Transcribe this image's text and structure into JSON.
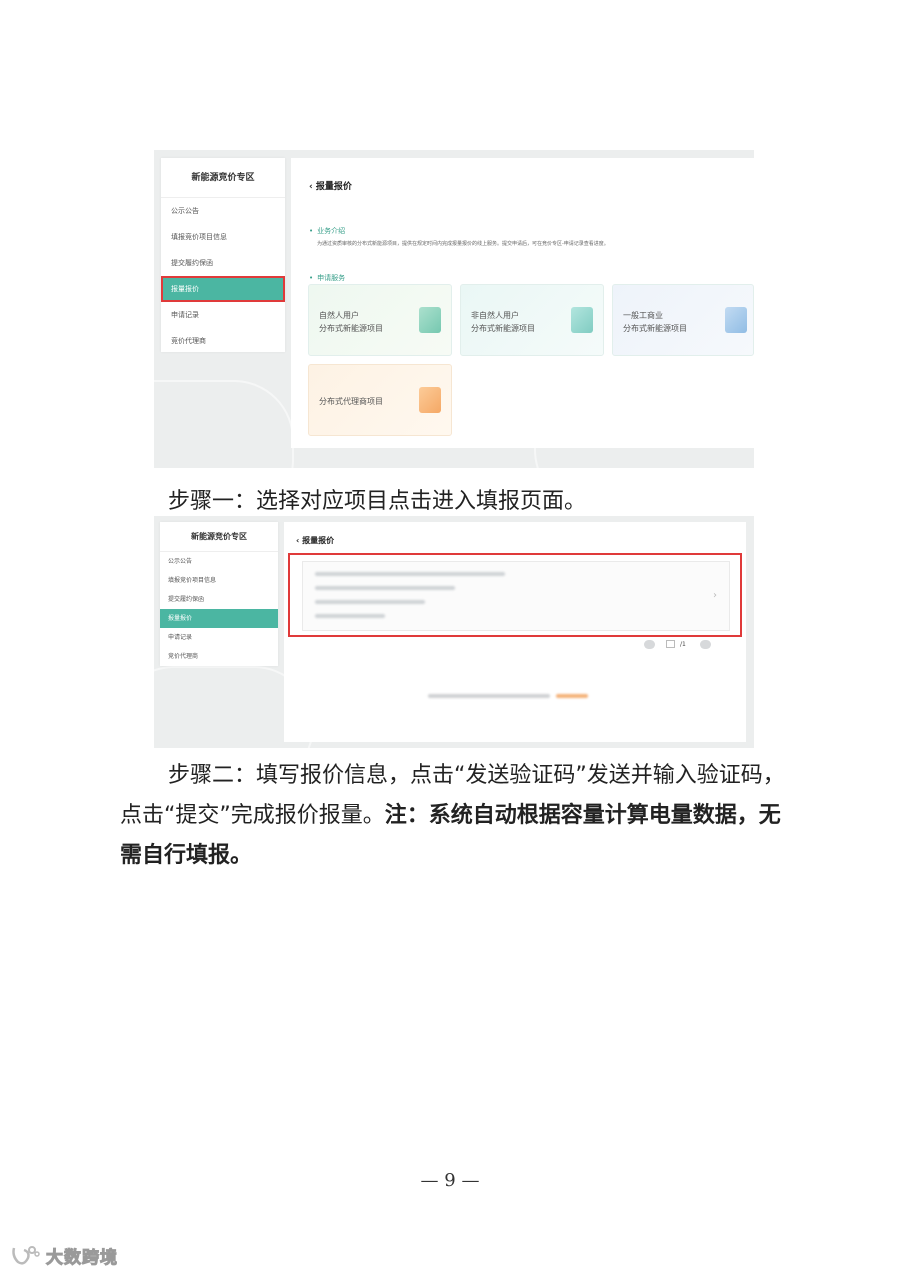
{
  "screenshot1": {
    "sidebar": {
      "title": "新能源竞价专区",
      "items": [
        "公示公告",
        "填报竞价项目信息",
        "提交履约保函",
        "报量报价",
        "申请记录",
        "竞价代理商"
      ]
    },
    "panel": {
      "back_title": "报量报价",
      "section_intro_title": "业务介绍",
      "section_intro_desc": "为通过资质审核的分布式新能源项目，提供在规定时间内完成报量报价的线上服务。提交申请后，可在竞价专区-申请记录查看进度。",
      "section_service_title": "申请服务",
      "cards": [
        {
          "line1": "自然人用户",
          "line2": "分布式新能源项目"
        },
        {
          "line1": "非自然人用户",
          "line2": "分布式新能源项目"
        },
        {
          "line1": "一般工商业",
          "line2": "分布式新能源项目"
        },
        {
          "line1": "分布式代理商项目",
          "line2": ""
        }
      ]
    }
  },
  "step1_text": "步骤一：选择对应项目点击进入填报页面。",
  "screenshot2": {
    "sidebar": {
      "title": "新能源竞价专区",
      "items": [
        "公示公告",
        "填报竞价项目信息",
        "提交履约保函",
        "报量报价",
        "申请记录",
        "竞价代理商"
      ]
    },
    "panel": {
      "back_title": "报量报价",
      "pager_text": "/1"
    }
  },
  "step2": {
    "normal": "步骤二：填写报价信息，点击“发送验证码”发送并输入验证码，点击“提交”完成报价报量。",
    "bold": "注：系统自动根据容量计算电量数据，无需自行填报。"
  },
  "page_number": "— 9 —",
  "watermark_text": "大数跨境",
  "colors": {
    "accent": "#4bb6a2",
    "highlight_border": "#e03a3a",
    "section_title": "#3aa08b"
  }
}
